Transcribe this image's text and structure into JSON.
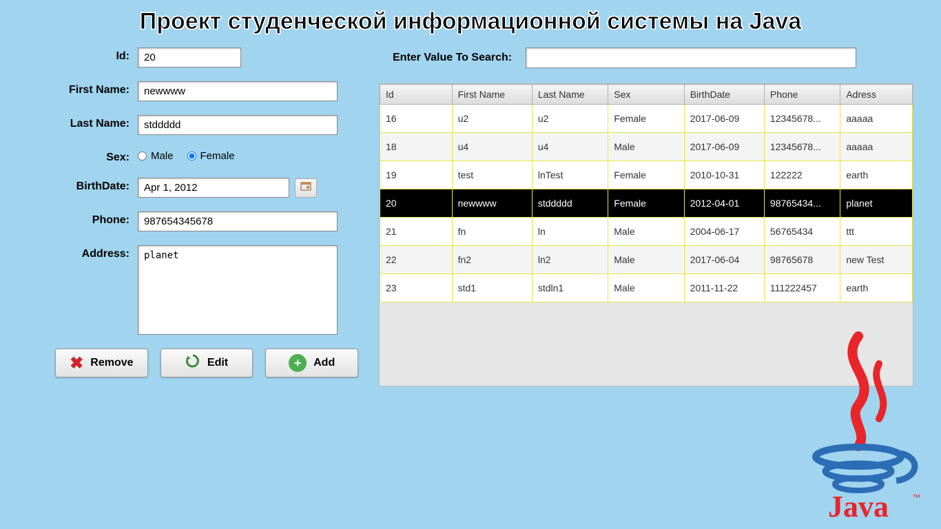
{
  "page_title": "Проект студенческой информационной системы на Java",
  "form": {
    "labels": {
      "id": "Id:",
      "first_name": "First Name:",
      "last_name": "Last Name:",
      "sex": "Sex:",
      "birthdate": "BirthDate:",
      "phone": "Phone:",
      "address": "Address:"
    },
    "values": {
      "id": "20",
      "first_name": "newwww",
      "last_name": "stddddd",
      "sex": "Female",
      "birthdate": "Apr 1, 2012",
      "phone": "987654345678",
      "address": "planet"
    },
    "sex_options": {
      "male": "Male",
      "female": "Female"
    }
  },
  "buttons": {
    "remove": "Remove",
    "edit": "Edit",
    "add": "Add"
  },
  "search": {
    "label": "Enter Value To Search:",
    "value": ""
  },
  "table": {
    "headers": [
      "Id",
      "First Name",
      "Last Name",
      "Sex",
      "BirthDate",
      "Phone",
      "Adress"
    ],
    "selected_index": 3,
    "rows": [
      [
        "16",
        "u2",
        "u2",
        "Female",
        "2017-06-09",
        "12345678...",
        "aaaaa"
      ],
      [
        "18",
        "u4",
        "u4",
        "Male",
        "2017-06-09",
        "12345678...",
        "aaaaa"
      ],
      [
        "19",
        "test",
        "lnTest",
        "Female",
        "2010-10-31",
        "122222",
        "earth"
      ],
      [
        "20",
        "newwww",
        "stddddd",
        "Female",
        "2012-04-01",
        "98765434...",
        "planet"
      ],
      [
        "21",
        "fn",
        "ln",
        "Male",
        "2004-06-17",
        "56765434",
        "ttt"
      ],
      [
        "22",
        "fn2",
        "ln2",
        "Male",
        "2017-06-04",
        "98765678",
        "new Test"
      ],
      [
        "23",
        "std1",
        "stdln1",
        "Male",
        "2011-11-22",
        "111222457",
        "earth"
      ]
    ]
  },
  "logo_text": "Java"
}
